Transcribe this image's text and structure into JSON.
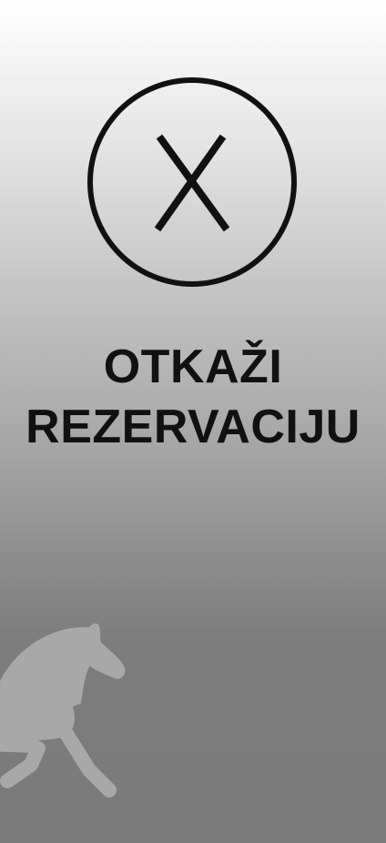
{
  "cancel_action": {
    "label_line1": "OTKAŽI",
    "label_line2": "REZERVACIJU",
    "icon": "close-circle-icon"
  },
  "background": {
    "gradient_top": "#ffffff",
    "gradient_bottom": "#7a7a7a",
    "watermark_icon": "horse-icon",
    "watermark_color": "#a8a8a8"
  }
}
